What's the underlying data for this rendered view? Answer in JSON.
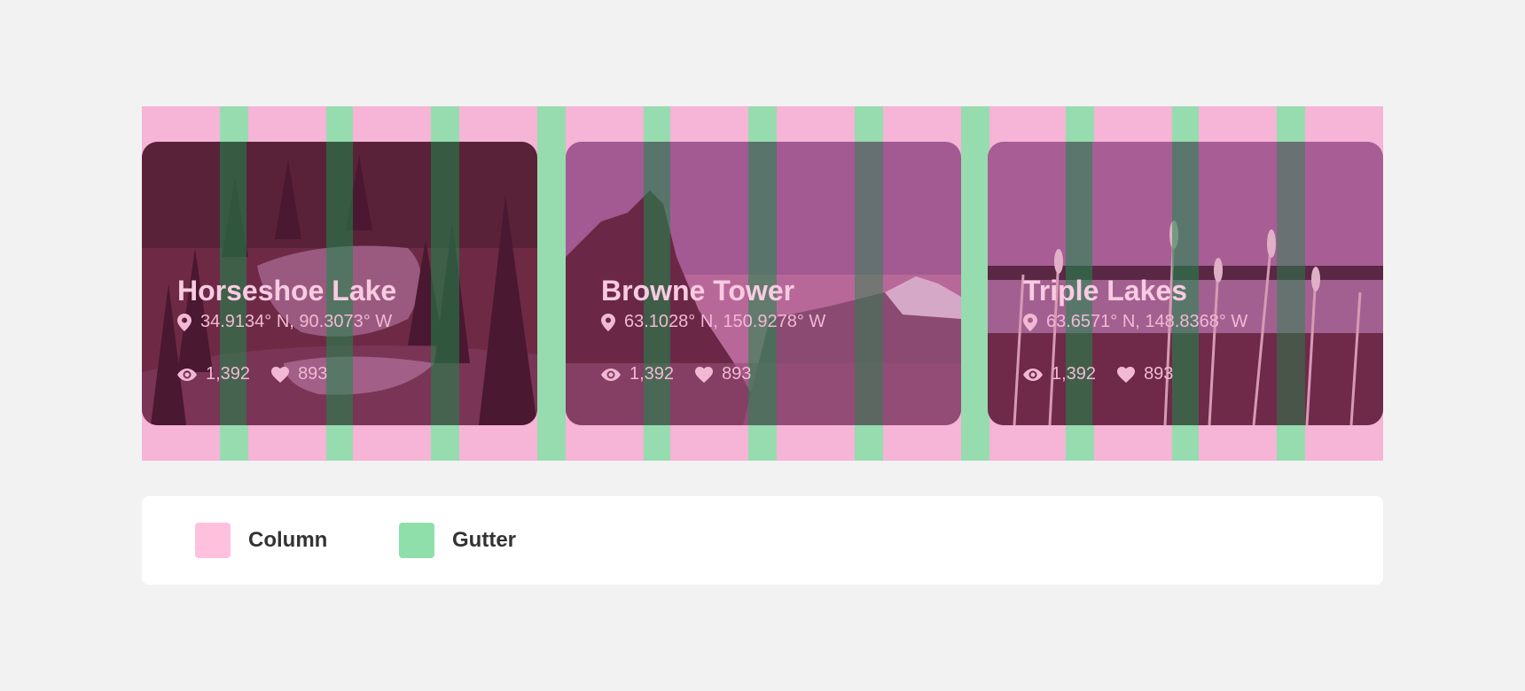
{
  "colors": {
    "column": "#ffc0de",
    "gutter": "#8fdfaa",
    "background": "#f2f2f2"
  },
  "cards": [
    {
      "title": "Horseshoe Lake",
      "coordinates": "34.9134° N, 90.3073° W",
      "views": "1,392",
      "likes": "893",
      "scene": "forest lake"
    },
    {
      "title": "Browne Tower",
      "coordinates": "63.1028° N, 150.9278° W",
      "views": "1,392",
      "likes": "893",
      "scene": "mountain peak"
    },
    {
      "title": "Triple Lakes",
      "coordinates": "63.6571° N, 148.8368° W",
      "views": "1,392",
      "likes": "893",
      "scene": "lake with reeds"
    }
  ],
  "icons": {
    "location": "map-pin-icon",
    "views": "eye-icon",
    "likes": "heart-icon"
  },
  "legend": {
    "column_label": "Column",
    "gutter_label": "Gutter"
  }
}
